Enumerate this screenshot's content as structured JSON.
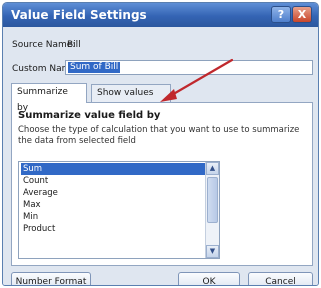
{
  "window": {
    "title": "Value Field Settings",
    "help_glyph": "?",
    "close_glyph": "X"
  },
  "source": {
    "label": "Source Name:",
    "value": "Bill"
  },
  "custom": {
    "label": "Custom Name:",
    "value": "Sum of Bill"
  },
  "tabs": [
    {
      "label": "Summarize by"
    },
    {
      "label": "Show values as"
    }
  ],
  "panel": {
    "heading": "Summarize value field by",
    "description": "Choose the type of calculation that you want to use to summarize the data from selected field"
  },
  "list": {
    "items": [
      "Sum",
      "Count",
      "Average",
      "Max",
      "Min",
      "Product"
    ],
    "selected": "Sum",
    "scroll_up_glyph": "▲",
    "scroll_down_glyph": "▼"
  },
  "buttons": {
    "number_format": "Number Format",
    "ok": "OK",
    "cancel": "Cancel"
  },
  "colors": {
    "annotation_arrow": "#c0282d",
    "selection": "#3169c6",
    "titlebar": "#3464b4"
  }
}
